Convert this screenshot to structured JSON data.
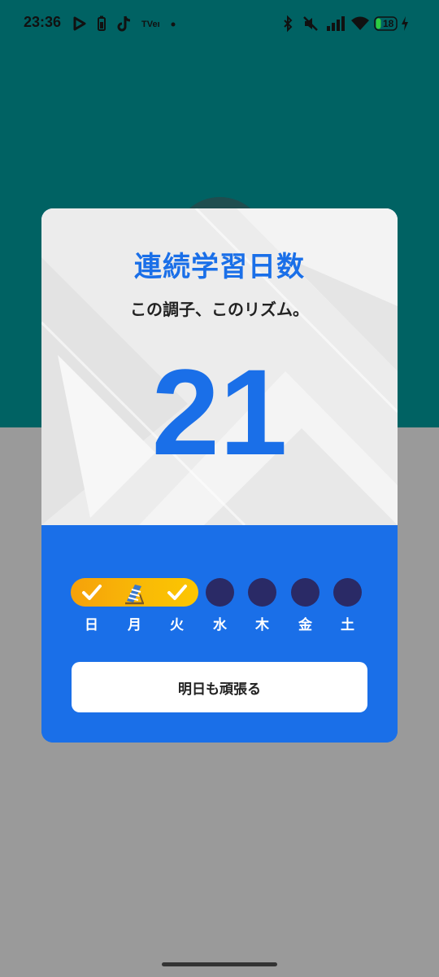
{
  "status_bar": {
    "time": "23:36",
    "battery_level": "18",
    "left_icons": [
      "play-icon",
      "battery-saver-icon",
      "tiktok-icon",
      "tver-icon",
      "dot-icon"
    ],
    "right_icons": [
      "bluetooth-icon",
      "mute-icon",
      "signal-icon",
      "wifi-icon",
      "battery-icon",
      "charging-icon"
    ]
  },
  "card": {
    "title": "連続学習日数",
    "subtitle": "この調子、このリズム。",
    "streak_count": "21",
    "week": {
      "days": [
        {
          "label": "日",
          "status": "done",
          "icon": "check-icon"
        },
        {
          "label": "月",
          "status": "rest",
          "icon": "beach-chair-icon"
        },
        {
          "label": "火",
          "status": "done",
          "icon": "check-icon"
        },
        {
          "label": "水",
          "status": "upcoming"
        },
        {
          "label": "木",
          "status": "upcoming"
        },
        {
          "label": "金",
          "status": "upcoming"
        },
        {
          "label": "土",
          "status": "upcoming"
        }
      ]
    },
    "button_label": "明日も頑張る"
  },
  "colors": {
    "teal_background": "#006263",
    "gray_background": "#9a9a9a",
    "accent_blue": "#1a6fe8",
    "streak_orange": "#f6a10a",
    "upcoming_dot": "#2a2a66"
  }
}
